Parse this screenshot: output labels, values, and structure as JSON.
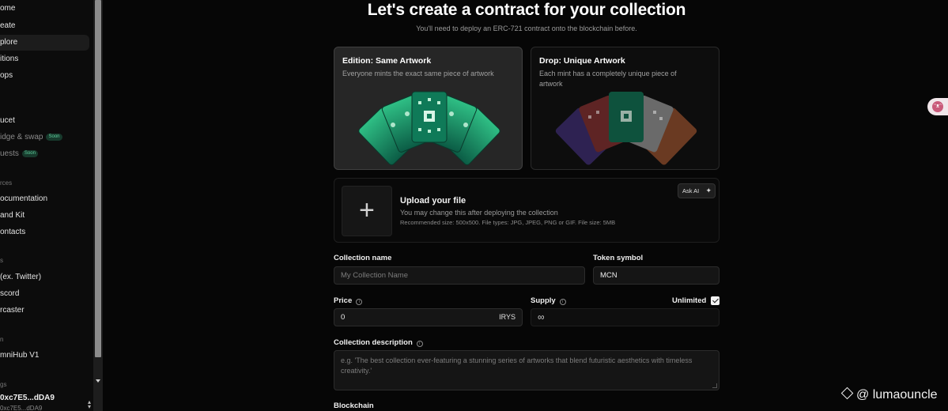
{
  "sidebar": {
    "items": [
      {
        "label": "ome"
      },
      {
        "label": "eate"
      },
      {
        "label": "plore"
      },
      {
        "label": "itions"
      },
      {
        "label": "ops"
      },
      {
        "label": "ucet"
      },
      {
        "label": "idge & swap",
        "badge": "Soon"
      },
      {
        "label": "uests",
        "badge": "Soon"
      },
      {
        "label": "ocumentation"
      },
      {
        "label": "and Kit"
      },
      {
        "label": "ontacts"
      },
      {
        "label": "(ex. Twitter)"
      },
      {
        "label": "scord"
      },
      {
        "label": "rcaster"
      },
      {
        "label": "mniHub V1"
      }
    ],
    "sections": [
      "rces",
      "s",
      "n",
      "gs"
    ],
    "wallet": {
      "address": "0xc7E5...dDA9",
      "sub": "0xc7E5...dDA9"
    }
  },
  "header": {
    "title": "Let's create a contract for your collection",
    "subtitle": "You'll need to deploy an ERC-721 contract onto the blockchain before."
  },
  "cards": [
    {
      "title": "Edition: Same Artwork",
      "desc": "Everyone mints the exact same piece of artwork",
      "selected": true
    },
    {
      "title": "Drop: Unique Artwork",
      "desc": "Each mint has a completely unique piece of artwork",
      "selected": false
    }
  ],
  "upload": {
    "title": "Upload your file",
    "desc": "You may change this after deploying the collection",
    "recommend": "Recommended size: 500x500. File types: JPG, JPEG, PNG or GIF. File size: 5MB",
    "ask_ai": "Ask AI"
  },
  "form": {
    "collection_name_label": "Collection name",
    "collection_name_placeholder": "My Collection Name",
    "token_symbol_label": "Token symbol",
    "token_symbol_value": "MCN",
    "price_label": "Price",
    "price_value": "0",
    "price_currency": "IRYS",
    "supply_label": "Supply",
    "supply_value": "∞",
    "unlimited_label": "Unlimited",
    "unlimited_checked": true,
    "description_label": "Collection description",
    "description_placeholder": "e.g. 'The best collection ever-featuring a stunning series of artworks that blend futuristic aesthetics with timeless creativity.'",
    "blockchain_label": "Blockchain"
  },
  "watermark": "@ lumaouncle"
}
